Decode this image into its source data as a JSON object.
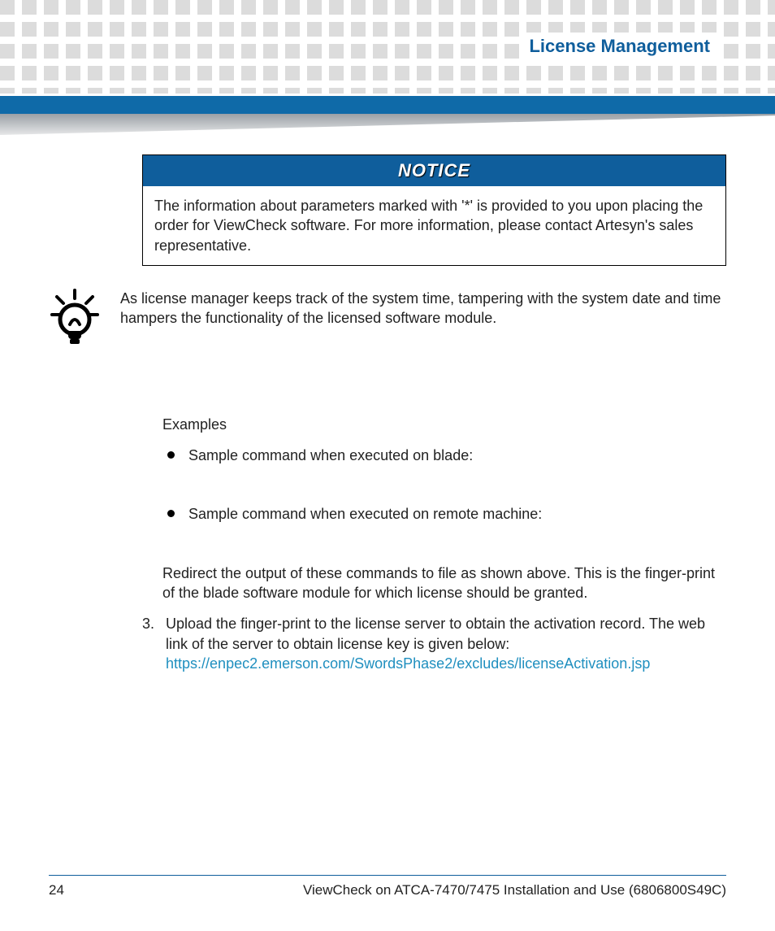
{
  "header": {
    "title": "License Management"
  },
  "notice": {
    "label": "NOTICE",
    "text": "The information about parameters marked with '*' is provided to you upon placing the order for ViewCheck software. For more information, please contact Artesyn's sales representative."
  },
  "tip": {
    "text": "As license manager keeps track of the system time, tampering with the system date and time hampers the functionality of the licensed software module."
  },
  "examples": {
    "heading": "Examples",
    "items": [
      "Sample command when executed on blade:",
      "Sample command when executed on remote machine:"
    ],
    "redirect": "Redirect the output of these commands to                 file as shown above. This is the finger-print of the blade software module for which license should be granted."
  },
  "step3": {
    "num": "3.",
    "text": "Upload the finger-print to the license server to obtain the activation record. The web link of the server to obtain license key is given below:",
    "link": "https://enpec2.emerson.com/SwordsPhase2/excludes/licenseActivation.jsp"
  },
  "footer": {
    "page": "24",
    "doc": "ViewCheck on ATCA-7470/7475 Installation and Use (6806800S49C)"
  }
}
